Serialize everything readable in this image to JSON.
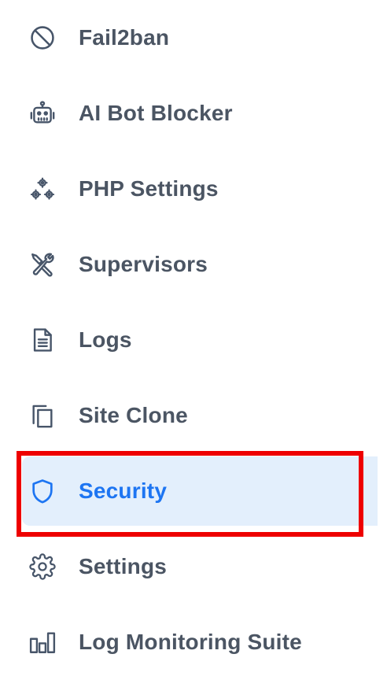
{
  "sidebar": {
    "items": [
      {
        "label": "Fail2ban",
        "icon": "ban-icon"
      },
      {
        "label": "AI Bot Blocker",
        "icon": "robot-icon"
      },
      {
        "label": "PHP Settings",
        "icon": "cogs-icon"
      },
      {
        "label": "Supervisors",
        "icon": "tools-icon"
      },
      {
        "label": "Logs",
        "icon": "document-icon"
      },
      {
        "label": "Site Clone",
        "icon": "copy-icon"
      },
      {
        "label": "Security",
        "icon": "shield-icon",
        "active": true
      },
      {
        "label": "Settings",
        "icon": "gear-icon"
      },
      {
        "label": "Log Monitoring Suite",
        "icon": "bar-chart-icon"
      }
    ]
  },
  "colors": {
    "text": "#4b5563",
    "icon": "#475569",
    "active_text": "#1d75f2",
    "active_bg": "#e3effc",
    "highlight_border": "#ee0000"
  }
}
